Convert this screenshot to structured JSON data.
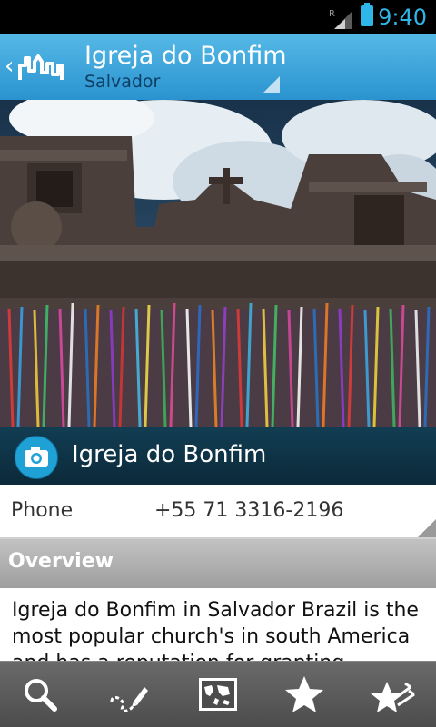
{
  "status_bar": {
    "time": "9:40",
    "roaming_indicator": "R",
    "signal_icon": "signal-icon",
    "battery_icon": "battery-icon"
  },
  "header": {
    "title": "Igreja do Bonfim",
    "subtitle": "Salvador",
    "back_icon": "back-chevron-icon",
    "logo_icon": "city-skyline-logo-icon"
  },
  "hero_image": {
    "description_icon": "church-photo"
  },
  "photo_caption": {
    "title": "Igreja do Bonfim",
    "icon": "camera-icon"
  },
  "details": {
    "phone_label": "Phone",
    "phone_value": "+55 71 3316-2196"
  },
  "overview": {
    "heading": "Overview",
    "text": "Igreja do Bonfim in Salvador Brazil is the most popular church's in south America and has a reputation for granting"
  },
  "bottom_nav": {
    "items": [
      {
        "icon": "search-icon"
      },
      {
        "icon": "route-pencil-icon"
      },
      {
        "icon": "map-icon"
      },
      {
        "icon": "star-icon"
      },
      {
        "icon": "favorite-star-arrow-icon"
      }
    ]
  },
  "colors": {
    "action_bar_top": "#55b8e6",
    "action_bar_bottom": "#2a93cf",
    "caption_bg": "#0b2a3a",
    "accent_blue": "#1fa1d6",
    "nav_bg": "#555555"
  }
}
